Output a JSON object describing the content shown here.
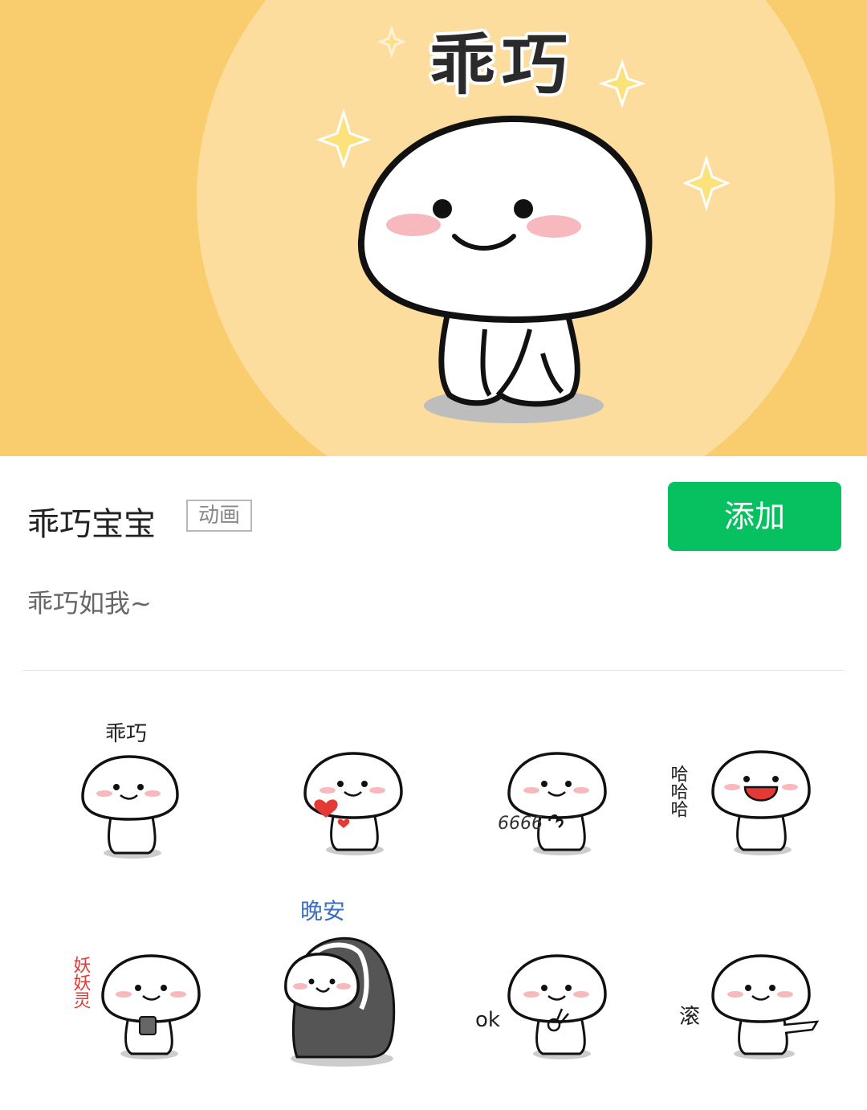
{
  "banner": {
    "title": "乖巧"
  },
  "pack": {
    "title": "乖巧宝宝",
    "badge": "动画",
    "add_label": "添加",
    "description": "乖巧如我~"
  },
  "stickers": [
    {
      "caption": "乖巧",
      "icon": "sticker-good-icon"
    },
    {
      "caption": "",
      "icon": "sticker-heart-icon"
    },
    {
      "caption": "6666",
      "icon": "sticker-666-icon"
    },
    {
      "caption": "哈哈哈",
      "icon": "sticker-laugh-icon"
    },
    {
      "caption": "妖妖灵",
      "icon": "sticker-phone-icon"
    },
    {
      "caption": "晚安",
      "icon": "sticker-goodnight-icon"
    },
    {
      "caption": "ok",
      "icon": "sticker-ok-icon"
    },
    {
      "caption": "滚",
      "icon": "sticker-go-away-icon"
    }
  ],
  "colors": {
    "banner_bg": "#F9CC6E",
    "banner_circle": "#FCDD9E",
    "add_button": "#07C160",
    "blush": "#F7B8BE"
  }
}
